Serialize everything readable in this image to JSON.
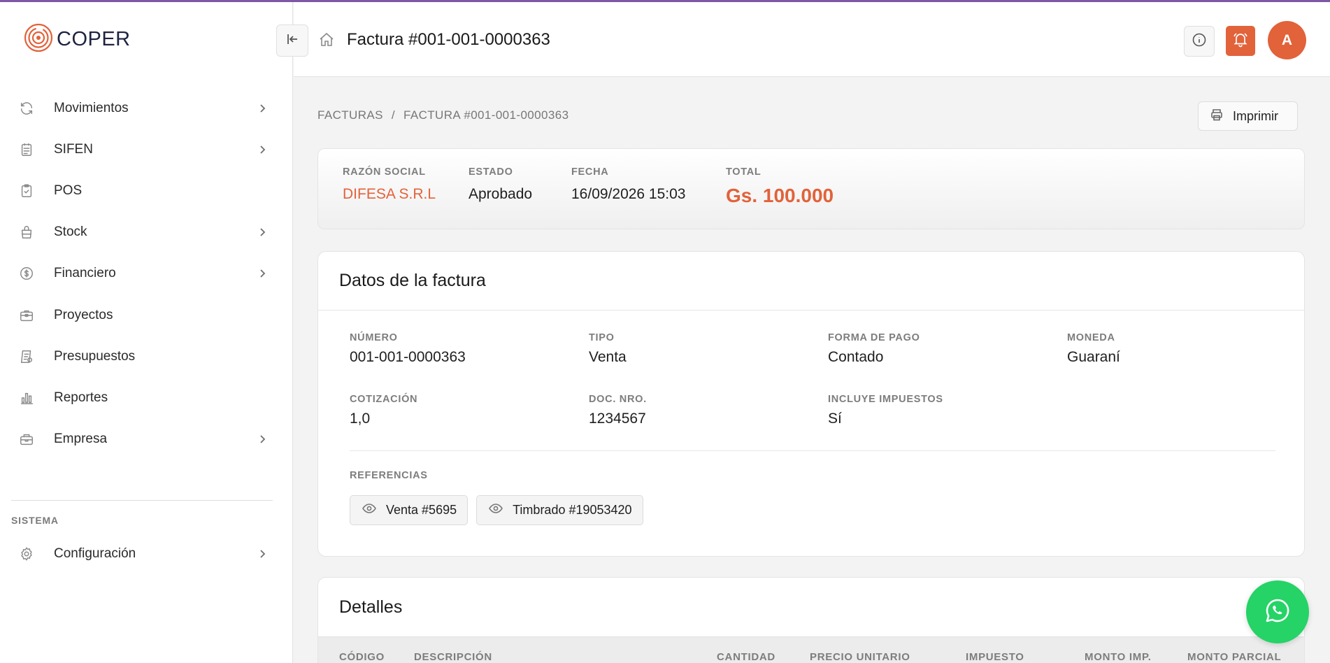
{
  "app": {
    "brand": "COPER",
    "accent": "#e2623a",
    "topline_color": "#7e57a6"
  },
  "sidebar": {
    "items": [
      {
        "label": "Movimientos",
        "icon": "refresh-icon",
        "has_submenu": true
      },
      {
        "label": "SIFEN",
        "icon": "document-icon",
        "has_submenu": true
      },
      {
        "label": "POS",
        "icon": "clipboard-check-icon",
        "has_submenu": false
      },
      {
        "label": "Stock",
        "icon": "bag-icon",
        "has_submenu": true
      },
      {
        "label": "Financiero",
        "icon": "dollar-icon",
        "has_submenu": true
      },
      {
        "label": "Proyectos",
        "icon": "briefcase-icon",
        "has_submenu": false
      },
      {
        "label": "Presupuestos",
        "icon": "receipt-icon",
        "has_submenu": false
      },
      {
        "label": "Reportes",
        "icon": "bar-chart-icon",
        "has_submenu": false
      },
      {
        "label": "Empresa",
        "icon": "toolbox-icon",
        "has_submenu": true
      }
    ],
    "section_label": "SISTEMA",
    "system_items": [
      {
        "label": "Configuración",
        "icon": "gear-icon",
        "has_submenu": true
      }
    ]
  },
  "header": {
    "title": "Factura #001-001-0000363",
    "avatar_initial": "A"
  },
  "breadcrumb": {
    "items": [
      "FACTURAS",
      "FACTURA #001-001-0000363"
    ],
    "separator": "/"
  },
  "actions": {
    "print_label": "Imprimir"
  },
  "summary": {
    "razon_social_label": "RAZÓN SOCIAL",
    "razon_social": "DIFESA S.R.L",
    "estado_label": "ESTADO",
    "estado": "Aprobado",
    "fecha_label": "FECHA",
    "fecha": "16/09/2026 15:03",
    "total_label": "TOTAL",
    "total": "Gs. 100.000"
  },
  "datos": {
    "title": "Datos de la factura",
    "numero_label": "NÚMERO",
    "numero": "001-001-0000363",
    "tipo_label": "TIPO",
    "tipo": "Venta",
    "forma_pago_label": "FORMA DE PAGO",
    "forma_pago": "Contado",
    "moneda_label": "MONEDA",
    "moneda": "Guaraní",
    "cotizacion_label": "COTIZACIÓN",
    "cotizacion": "1,0",
    "doc_nro_label": "DOC. NRO.",
    "doc_nro": "1234567",
    "incluye_impuestos_label": "INCLUYE IMPUESTOS",
    "incluye_impuestos": "Sí",
    "referencias_label": "REFERENCIAS",
    "referencias": [
      "Venta #5695",
      "Timbrado #19053420"
    ]
  },
  "detalles": {
    "title": "Detalles",
    "columns": [
      "CÓDIGO",
      "DESCRIPCIÓN",
      "CANTIDAD",
      "PRECIO UNITARIO",
      "IMPUESTO",
      "MONTO IMP.",
      "MONTO PARCIAL"
    ]
  }
}
